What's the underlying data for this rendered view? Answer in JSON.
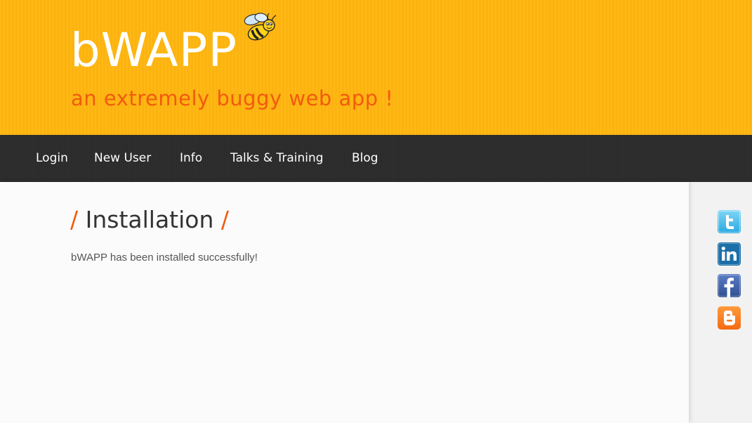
{
  "header": {
    "logo_text": "bWAPP",
    "tagline": "an extremely buggy web app !"
  },
  "nav": {
    "items": [
      {
        "label": "Login"
      },
      {
        "label": "New User"
      },
      {
        "label": "Info"
      },
      {
        "label": "Talks & Training"
      },
      {
        "label": "Blog"
      }
    ]
  },
  "main": {
    "title_slash_left": "/",
    "title": "Installation",
    "title_slash_right": "/",
    "message": "bWAPP has been installed successfully!"
  },
  "social": {
    "icons": [
      "twitter-icon",
      "linkedin-icon",
      "facebook-icon",
      "blogger-icon"
    ]
  },
  "colors": {
    "header_bg": "#ffb60f",
    "accent": "#f25a0e",
    "nav_bg": "#2c2c2c",
    "content_bg": "#fbfbfb"
  }
}
